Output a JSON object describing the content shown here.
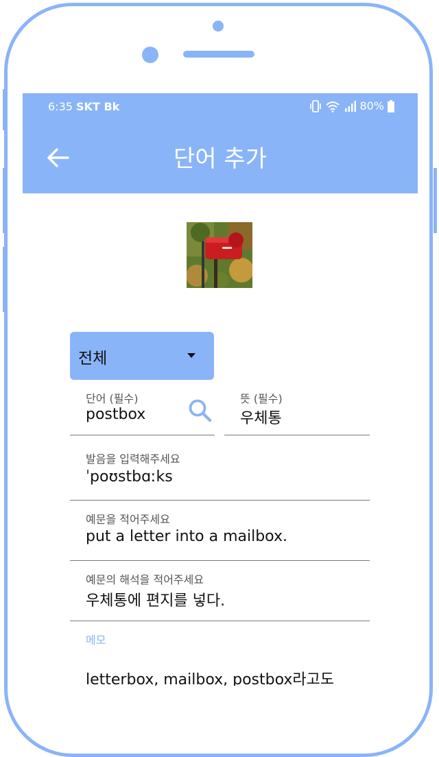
{
  "status_bar": {
    "time": "6:35",
    "carrier": "SKT Bk",
    "battery": "80%"
  },
  "app_bar": {
    "title": "단어 추가"
  },
  "category_dropdown": {
    "selected": "전체"
  },
  "word_field": {
    "label": "단어 (필수)",
    "value": "postbox"
  },
  "meaning_field": {
    "label": "뜻 (필수)",
    "value": "우체통"
  },
  "pronunciation_field": {
    "label": "발음을 입력해주세요",
    "value": "ˈpoʊstbɑːks"
  },
  "example_field": {
    "label": "예문을 적어주세요",
    "value": "put a letter into a mailbox."
  },
  "example_translation_field": {
    "label": "예문의 해석을 적어주세요",
    "value": "우체통에 편지를 넣다."
  },
  "memo_field": {
    "label": "메모",
    "value": "letterbox, mailbox, postbox라고도"
  },
  "colors": {
    "accent": "#8ab4f8",
    "focus_label": "#8ab4f8"
  }
}
